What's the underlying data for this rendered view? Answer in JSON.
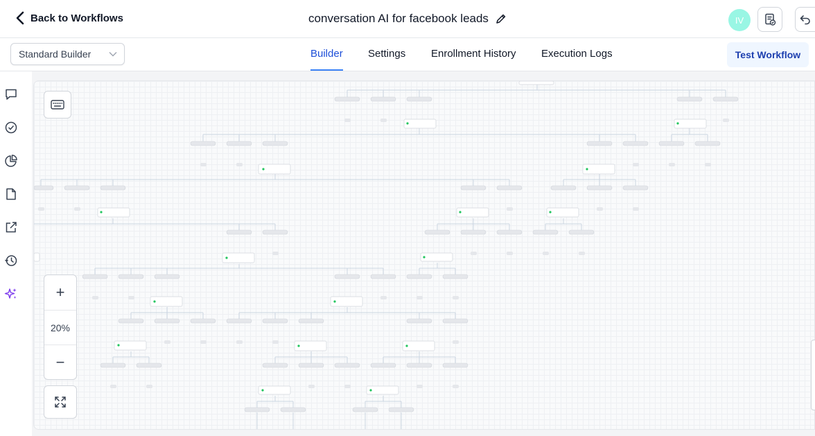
{
  "header": {
    "back_label": "Back to Workflows",
    "workflow_name": "conversation AI for facebook leads",
    "avatar_initials": "IV",
    "avatar_color": "#99f6e4"
  },
  "toolbar": {
    "builder_mode": "Standard Builder",
    "tabs": [
      {
        "label": "Builder",
        "active": true
      },
      {
        "label": "Settings",
        "active": false
      },
      {
        "label": "Enrollment History",
        "active": false
      },
      {
        "label": "Execution Logs",
        "active": false
      }
    ],
    "test_button_label": "Test Workflow"
  },
  "sidebar": {
    "icons": [
      "chat-icon",
      "check-circle-icon",
      "pie-chart-icon",
      "document-icon",
      "external-link-icon",
      "history-icon",
      "sparkles-icon"
    ]
  },
  "canvas": {
    "zoom_label": "20%",
    "zoom_in_label": "+",
    "zoom_out_label": "−"
  },
  "colors": {
    "accent": "#3b82f6",
    "accent_text": "#1d4ed8",
    "ai_icon": "#7c3aed",
    "node_dot": "#22c55e"
  }
}
